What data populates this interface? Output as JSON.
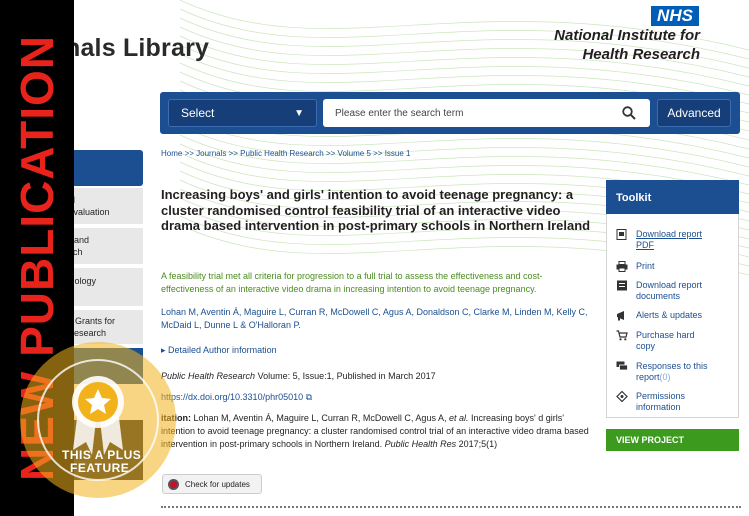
{
  "header": {
    "site_title": "Journals Library",
    "nhs": "NHS",
    "org_line1": "National Institute for",
    "org_line2": "Health Research"
  },
  "search": {
    "select_label": "Select",
    "placeholder": "Please enter the search term",
    "advanced_label": "Advanced"
  },
  "breadcrumb": "Home >> Journals >> Public Health Research >> Volume 5 >> Issue 1",
  "left_menu": {
    "items": [
      "and\nn Evaluation",
      "ies and\nearch",
      "chnology\nt",
      "me Grants for\nd Research"
    ]
  },
  "article": {
    "title": "Increasing boys' and girls' intention to avoid teenage pregnancy: a cluster randomised control feasibility trial of an interactive video drama based intervention in post-primary schools in Northern Ireland",
    "summary": "A feasibility trial met all criteria for progression to a full trial to assess the effectiveness and cost-effectiveness of an interactive video drama in increasing intention to avoid teenage pregnancy.",
    "authors": "Lohan M, Aventin Á, Maguire L, Curran R, McDowell C, Agus A, Donaldson C, Clarke M, Linden M, Kelly C, McDaid L, Dunne L & O'Halloran P.",
    "detailed_author": "▸ Detailed Author information",
    "journal": "Public Health Research",
    "pub_rest": " Volume: 5, Issue:1, Published in March 2017",
    "doi": "https://dx.doi.org/10.3310/phr05010 ⧉",
    "citation_label": "itation:",
    "citation_text": " Lohan M, Aventin Á, Maguire L, Curran R, McDowell C, Agus A, ",
    "citation_etal": "et al.",
    "citation_text2": " Increasing boys' d girls' intention to avoid teenage pregnancy: a cluster randomised control trial of an interactive video drama based intervention in post-primary schools in Northern Ireland. ",
    "citation_journal": "Public Health Res",
    "citation_end": " 2017;5(1)",
    "check_updates": "Check for updates"
  },
  "toolkit": {
    "title": "Toolkit",
    "items": [
      {
        "line1": "Download report",
        "line2": "PDF",
        "icon": "pdf-icon"
      },
      {
        "line1": "Print",
        "line2": "",
        "icon": "print-icon"
      },
      {
        "line1": "Download report",
        "line2": "documents",
        "icon": "document-icon"
      },
      {
        "line1": "Alerts & updates",
        "line2": "",
        "icon": "megaphone-icon"
      },
      {
        "line1": "Purchase hard",
        "line2": "copy",
        "icon": "cart-icon"
      },
      {
        "line1": "Responses to this",
        "line2": "report",
        "count": "(0)",
        "icon": "comments-icon"
      },
      {
        "line1": "Permissions",
        "line2": "information",
        "icon": "permissions-icon"
      }
    ],
    "view_project": "VIEW PROJECT"
  },
  "overlay": {
    "new_publication": "NEW PUBLICATION",
    "badge_line1": "THIS A PLUS",
    "badge_line2": "FEATURE"
  },
  "colors": {
    "nihr_blue": "#1b4f91",
    "summary_green": "#4a8c1f",
    "view_green": "#3c9a1e",
    "new_red": "#e8231c",
    "badge_gold": "#f2b21b"
  }
}
